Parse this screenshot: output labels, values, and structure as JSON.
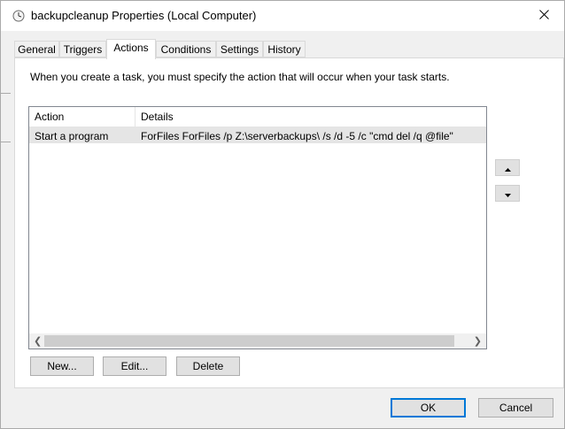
{
  "window": {
    "title": "backupcleanup Properties (Local Computer)"
  },
  "tabs": [
    "General",
    "Triggers",
    "Actions",
    "Conditions",
    "Settings",
    "History"
  ],
  "panel": {
    "description": "When you create a task, you must specify the action that will occur when your task starts.",
    "columns": [
      "Action",
      "Details"
    ],
    "rows": [
      {
        "action": "Start a program",
        "details": "ForFiles ForFiles /p Z:\\serverbackups\\ /s /d -5 /c \"cmd del /q @file\""
      }
    ],
    "buttons": {
      "new": "New...",
      "edit": "Edit...",
      "delete": "Delete"
    }
  },
  "footer": {
    "ok": "OK",
    "cancel": "Cancel"
  },
  "icons": {
    "title": "task-clock-icon",
    "close": "close-icon",
    "move_up": "arrow-up-icon",
    "move_down": "arrow-down-icon"
  },
  "colors": {
    "accent": "#0078d7",
    "selected_row": "#e5e5e5"
  }
}
